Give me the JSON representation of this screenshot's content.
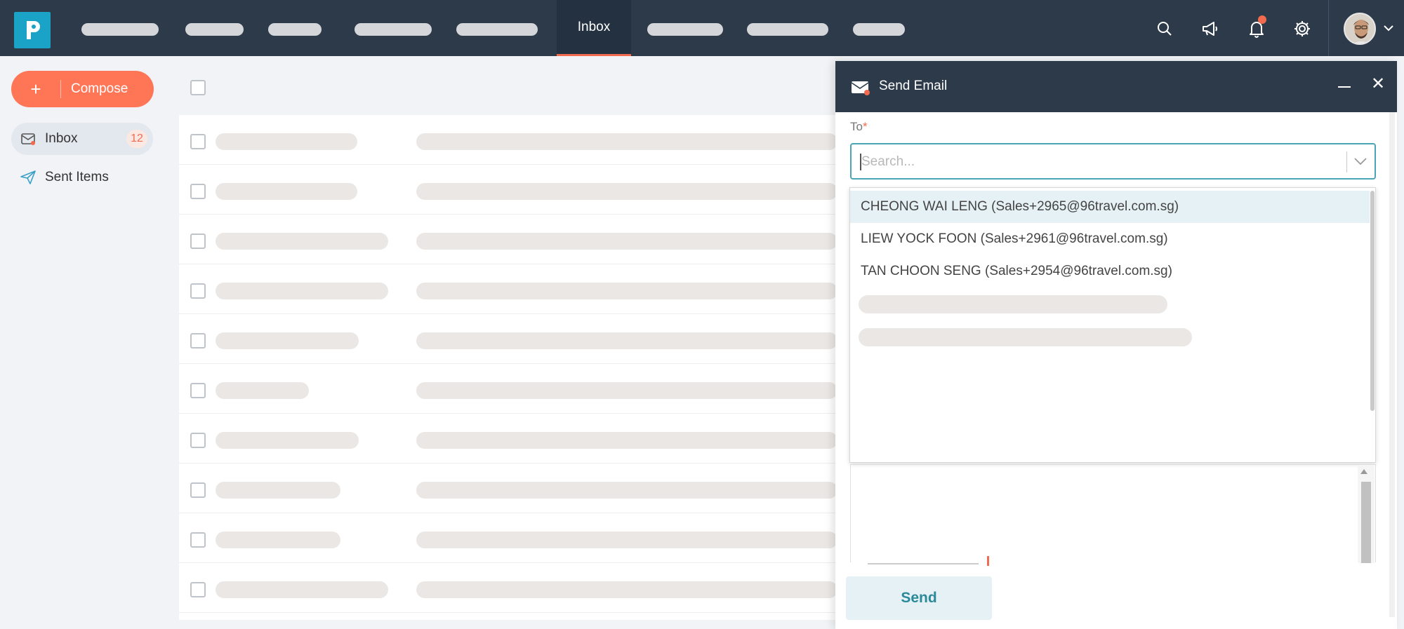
{
  "nav": {
    "active_tab": "Inbox",
    "brand_color": "#1aa3c7",
    "accent_color": "#f36b4f",
    "icons": [
      "search-icon",
      "megaphone-icon",
      "bell-icon",
      "gear-icon"
    ]
  },
  "sidebar": {
    "compose_label": "Compose",
    "items": [
      {
        "label": "Inbox",
        "count": "12",
        "icon": "inbox-icon"
      },
      {
        "label": "Sent Items",
        "icon": "paper-plane-icon"
      }
    ]
  },
  "send_email": {
    "title": "Send Email",
    "to_label": "To",
    "to_required": "*",
    "search_placeholder": "Search...",
    "suggestions": [
      "CHEONG WAI LENG (Sales+2965@96travel.com.sg)",
      "LIEW YOCK FOON (Sales+2961@96travel.com.sg)",
      "TAN CHOON SENG (Sales+2954@96travel.com.sg)"
    ],
    "send_label": "Send"
  }
}
